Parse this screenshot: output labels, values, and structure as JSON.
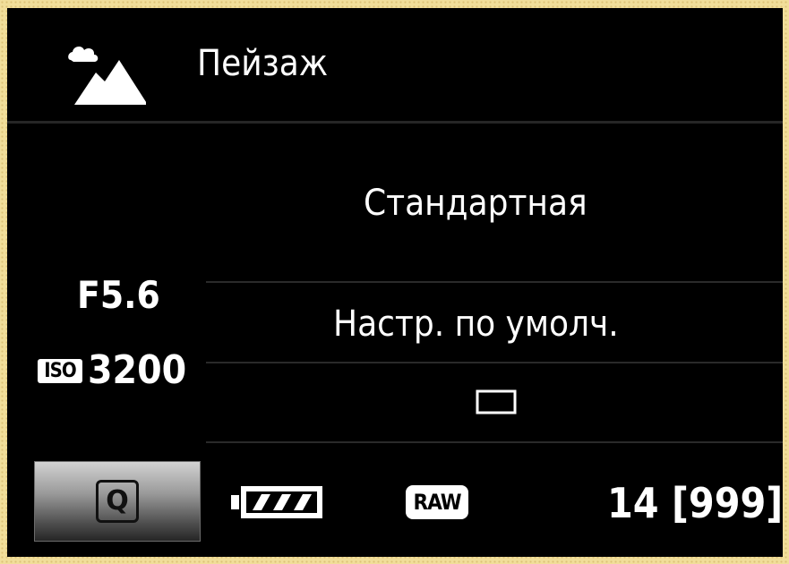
{
  "screen": {
    "mode_icon": "landscape-mode-icon",
    "mode_title": "Пейзаж",
    "picture_style": "Стандартная",
    "settings_default": "Настр. по умолч.",
    "drive_mode_icon": "single-shot-drive-icon",
    "exposure": {
      "aperture": "F5.6",
      "iso_label": "ISO",
      "iso_value": "3200"
    },
    "status_bar": {
      "quick_control_label": "Q",
      "quick_control_icon": "quick-control-icon",
      "battery_icon": "battery-icon",
      "battery_level": 1.0,
      "image_quality": "RAW",
      "shots_remaining": "14 [999]"
    }
  },
  "colors": {
    "background": "#000000",
    "text": "#ffffff",
    "frame": "#f1de9a"
  }
}
